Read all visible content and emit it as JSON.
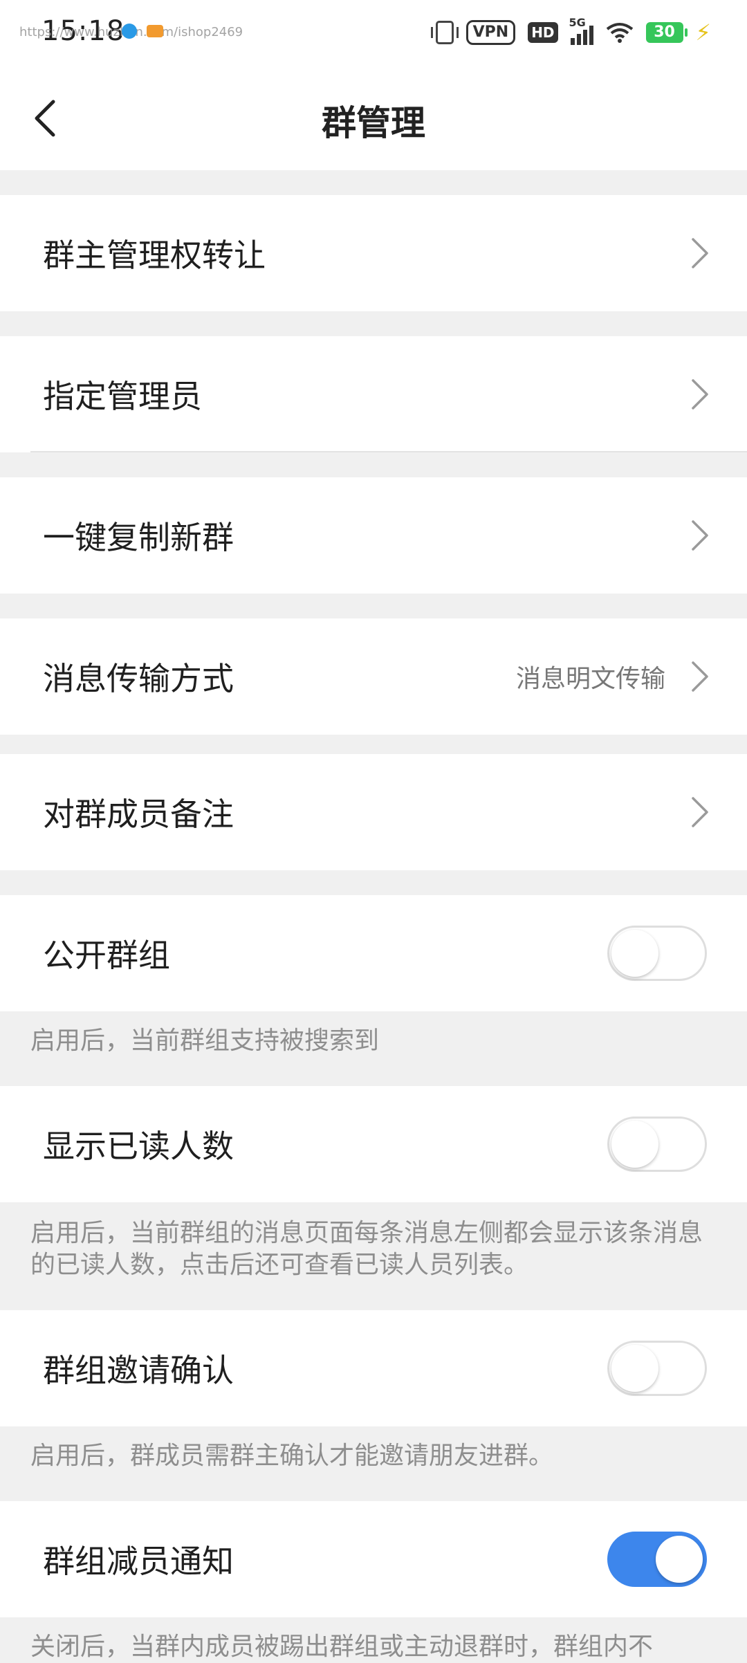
{
  "status_bar": {
    "time": "15:18",
    "watermark": "https://www.huzhan.com/ishop2469",
    "vpn": "VPN",
    "hd": "HD",
    "network": "5G",
    "battery": "30"
  },
  "header": {
    "title": "群管理"
  },
  "rows": {
    "transfer": {
      "label": "群主管理权转让"
    },
    "admins": {
      "label": "指定管理员"
    },
    "copy_group": {
      "label": "一键复制新群"
    },
    "transmission": {
      "label": "消息传输方式",
      "value": "消息明文传输"
    },
    "remarks": {
      "label": "对群成员备注"
    },
    "public_group": {
      "label": "公开群组",
      "on": false,
      "desc": "启用后，当前群组支持被搜索到"
    },
    "read_count": {
      "label": "显示已读人数",
      "on": false,
      "desc": "启用后，当前群组的消息页面每条消息左侧都会显示该条消息的已读人数，点击后还可查看已读人员列表。"
    },
    "invite_confirm": {
      "label": "群组邀请确认",
      "on": false,
      "desc": "启用后，群成员需群主确认才能邀请朋友进群。"
    },
    "leave_notice": {
      "label": "群组减员通知",
      "on": true,
      "desc": "关闭后，当群内成员被踢出群组或主动退群时，群组内不"
    }
  },
  "colors": {
    "toggle_on": "#3d86ec",
    "background": "#f0f0f0",
    "desc_text": "#8e8e8e"
  }
}
